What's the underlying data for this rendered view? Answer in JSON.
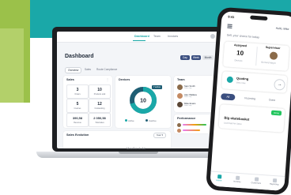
{
  "colors": {
    "teal": "#1aa8a8",
    "green": "#9bc14a",
    "navy": "#3b4f80",
    "donut_accent": "#1aa8a8",
    "donut_base": "#1f5e74"
  },
  "laptop": {
    "brand": "MacBook Air",
    "nav": {
      "items": [
        "Dashboard",
        "Team",
        "Invoices"
      ],
      "active": "Dashboard"
    },
    "title": "Dashboard",
    "periods": [
      "Day",
      "Week",
      "Month"
    ],
    "subtabs": [
      "Overview",
      "Sales",
      "Route Compliance"
    ],
    "sales": {
      "title": "Sales",
      "stats": [
        {
          "value": "3",
          "label": "Orders"
        },
        {
          "value": "10",
          "label": "Products sold"
        },
        {
          "value": "5",
          "label": "Invoices"
        },
        {
          "value": "12",
          "label": "Outstanding"
        },
        {
          "value": "390,58",
          "label": "Revenue"
        },
        {
          "value": "2 050,58",
          "label": "Total sales"
        }
      ]
    },
    "devices": {
      "title": "Devices",
      "center_value": "10",
      "legend": [
        "Active",
        "Inactive"
      ],
      "tooltip": "7 active"
    },
    "team": {
      "title": "Team",
      "members": [
        {
          "name": "Sam Smith",
          "sub": "Sales rep"
        },
        {
          "name": "Alex Wallace",
          "sub": "Sales rep"
        },
        {
          "name": "Mike Evans",
          "sub": "Sales rep"
        }
      ]
    },
    "performance": {
      "title": "Performance"
    },
    "sales_evolution": {
      "title": "Sales Evolution",
      "select": "Year"
    }
  },
  "phone": {
    "status_time": "9:41",
    "hello": "Hello, Mike",
    "banner": "Sell, your choice for today",
    "assigned": {
      "label": "Assigned",
      "value": "10",
      "sub": "Devices"
    },
    "supervisor": {
      "label": "Supervisor",
      "sub": "Bernard Mayer"
    },
    "quoting": {
      "title": "Quoting",
      "sub": "View now"
    },
    "tabs": [
      "All",
      "Incoming",
      "Done"
    ],
    "order": {
      "title": "Big skatebasket",
      "sub": "Lovemail Art Store",
      "badge": "Done"
    },
    "bottom_nav": [
      "Home",
      "Invoices",
      "Customers",
      "Reporting"
    ]
  }
}
